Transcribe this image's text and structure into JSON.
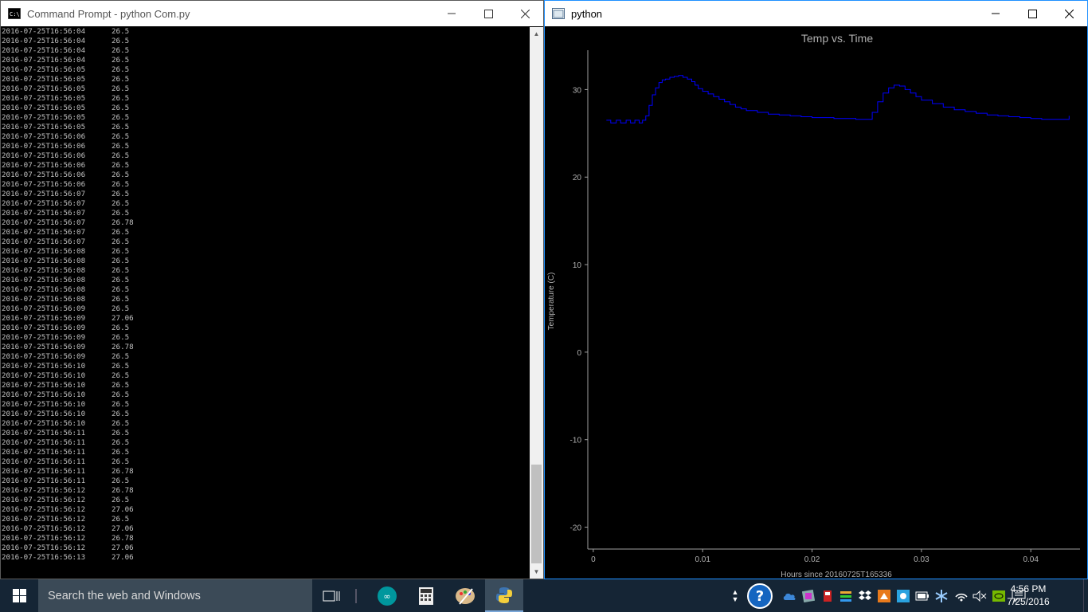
{
  "cmd_window": {
    "title": "Command Prompt - python  Com.py",
    "log": [
      {
        "ts": "2016-07-25T16:56:04",
        "val": "26.5"
      },
      {
        "ts": "2016-07-25T16:56:04",
        "val": "26.5"
      },
      {
        "ts": "2016-07-25T16:56:04",
        "val": "26.5"
      },
      {
        "ts": "2016-07-25T16:56:04",
        "val": "26.5"
      },
      {
        "ts": "2016-07-25T16:56:05",
        "val": "26.5"
      },
      {
        "ts": "2016-07-25T16:56:05",
        "val": "26.5"
      },
      {
        "ts": "2016-07-25T16:56:05",
        "val": "26.5"
      },
      {
        "ts": "2016-07-25T16:56:05",
        "val": "26.5"
      },
      {
        "ts": "2016-07-25T16:56:05",
        "val": "26.5"
      },
      {
        "ts": "2016-07-25T16:56:05",
        "val": "26.5"
      },
      {
        "ts": "2016-07-25T16:56:05",
        "val": "26.5"
      },
      {
        "ts": "2016-07-25T16:56:06",
        "val": "26.5"
      },
      {
        "ts": "2016-07-25T16:56:06",
        "val": "26.5"
      },
      {
        "ts": "2016-07-25T16:56:06",
        "val": "26.5"
      },
      {
        "ts": "2016-07-25T16:56:06",
        "val": "26.5"
      },
      {
        "ts": "2016-07-25T16:56:06",
        "val": "26.5"
      },
      {
        "ts": "2016-07-25T16:56:06",
        "val": "26.5"
      },
      {
        "ts": "2016-07-25T16:56:07",
        "val": "26.5"
      },
      {
        "ts": "2016-07-25T16:56:07",
        "val": "26.5"
      },
      {
        "ts": "2016-07-25T16:56:07",
        "val": "26.5"
      },
      {
        "ts": "2016-07-25T16:56:07",
        "val": "26.78"
      },
      {
        "ts": "2016-07-25T16:56:07",
        "val": "26.5"
      },
      {
        "ts": "2016-07-25T16:56:07",
        "val": "26.5"
      },
      {
        "ts": "2016-07-25T16:56:08",
        "val": "26.5"
      },
      {
        "ts": "2016-07-25T16:56:08",
        "val": "26.5"
      },
      {
        "ts": "2016-07-25T16:56:08",
        "val": "26.5"
      },
      {
        "ts": "2016-07-25T16:56:08",
        "val": "26.5"
      },
      {
        "ts": "2016-07-25T16:56:08",
        "val": "26.5"
      },
      {
        "ts": "2016-07-25T16:56:08",
        "val": "26.5"
      },
      {
        "ts": "2016-07-25T16:56:09",
        "val": "26.5"
      },
      {
        "ts": "2016-07-25T16:56:09",
        "val": "27.06"
      },
      {
        "ts": "2016-07-25T16:56:09",
        "val": "26.5"
      },
      {
        "ts": "2016-07-25T16:56:09",
        "val": "26.5"
      },
      {
        "ts": "2016-07-25T16:56:09",
        "val": "26.78"
      },
      {
        "ts": "2016-07-25T16:56:09",
        "val": "26.5"
      },
      {
        "ts": "2016-07-25T16:56:10",
        "val": "26.5"
      },
      {
        "ts": "2016-07-25T16:56:10",
        "val": "26.5"
      },
      {
        "ts": "2016-07-25T16:56:10",
        "val": "26.5"
      },
      {
        "ts": "2016-07-25T16:56:10",
        "val": "26.5"
      },
      {
        "ts": "2016-07-25T16:56:10",
        "val": "26.5"
      },
      {
        "ts": "2016-07-25T16:56:10",
        "val": "26.5"
      },
      {
        "ts": "2016-07-25T16:56:10",
        "val": "26.5"
      },
      {
        "ts": "2016-07-25T16:56:11",
        "val": "26.5"
      },
      {
        "ts": "2016-07-25T16:56:11",
        "val": "26.5"
      },
      {
        "ts": "2016-07-25T16:56:11",
        "val": "26.5"
      },
      {
        "ts": "2016-07-25T16:56:11",
        "val": "26.5"
      },
      {
        "ts": "2016-07-25T16:56:11",
        "val": "26.78"
      },
      {
        "ts": "2016-07-25T16:56:11",
        "val": "26.5"
      },
      {
        "ts": "2016-07-25T16:56:12",
        "val": "26.78"
      },
      {
        "ts": "2016-07-25T16:56:12",
        "val": "26.5"
      },
      {
        "ts": "2016-07-25T16:56:12",
        "val": "27.06"
      },
      {
        "ts": "2016-07-25T16:56:12",
        "val": "26.5"
      },
      {
        "ts": "2016-07-25T16:56:12",
        "val": "27.06"
      },
      {
        "ts": "2016-07-25T16:56:12",
        "val": "26.78"
      },
      {
        "ts": "2016-07-25T16:56:12",
        "val": "27.06"
      },
      {
        "ts": "2016-07-25T16:56:13",
        "val": "27.06"
      }
    ]
  },
  "plot_window": {
    "title": "python"
  },
  "chart_data": {
    "type": "line",
    "title": "Temp vs. Time",
    "xlabel": "Hours since 20160725T165336",
    "ylabel": "Temperature (C)",
    "xlim": [
      -0.0005,
      0.0445
    ],
    "ylim": [
      -22.5,
      34.5
    ],
    "x_ticks": [
      0,
      0.01,
      0.02,
      0.03,
      0.04
    ],
    "x_tick_labels": [
      "0",
      "0.01",
      "0.02",
      "0.03",
      "0.04"
    ],
    "y_ticks": [
      30,
      20,
      10,
      0,
      -10,
      -20
    ],
    "y_tick_labels": [
      "30",
      "20",
      "10",
      "0",
      "-10",
      "-20"
    ],
    "grid": false,
    "series": [
      {
        "color": "#0000ff",
        "x": [
          0.0012,
          0.0016,
          0.0021,
          0.0025,
          0.003,
          0.0034,
          0.0038,
          0.0042,
          0.0045,
          0.0048,
          0.0051,
          0.0054,
          0.0057,
          0.006,
          0.0063,
          0.0066,
          0.007,
          0.0074,
          0.0078,
          0.0082,
          0.0086,
          0.009,
          0.0093,
          0.0096,
          0.01,
          0.0105,
          0.011,
          0.0115,
          0.012,
          0.0125,
          0.013,
          0.0135,
          0.014,
          0.015,
          0.016,
          0.017,
          0.018,
          0.019,
          0.02,
          0.021,
          0.022,
          0.023,
          0.024,
          0.025,
          0.0255,
          0.026,
          0.0265,
          0.027,
          0.0275,
          0.028,
          0.0285,
          0.029,
          0.0295,
          0.03,
          0.031,
          0.032,
          0.033,
          0.034,
          0.035,
          0.036,
          0.037,
          0.038,
          0.039,
          0.04,
          0.041,
          0.042,
          0.043,
          0.0435
        ],
        "y": [
          26.5,
          26.2,
          26.5,
          26.2,
          26.5,
          26.2,
          26.5,
          26.2,
          26.5,
          27.0,
          28.2,
          29.4,
          30.2,
          30.8,
          31.1,
          31.2,
          31.4,
          31.5,
          31.6,
          31.4,
          31.2,
          30.9,
          30.5,
          30.1,
          29.8,
          29.5,
          29.2,
          28.9,
          28.6,
          28.3,
          28.0,
          27.8,
          27.6,
          27.4,
          27.2,
          27.1,
          27.0,
          26.9,
          26.8,
          26.8,
          26.7,
          26.7,
          26.6,
          26.6,
          27.4,
          28.6,
          29.6,
          30.2,
          30.5,
          30.4,
          30.0,
          29.6,
          29.2,
          28.8,
          28.4,
          28.0,
          27.7,
          27.5,
          27.3,
          27.1,
          27.0,
          26.9,
          26.8,
          26.7,
          26.6,
          26.6,
          26.6,
          27.0
        ]
      }
    ]
  },
  "taskbar": {
    "search_placeholder": "Search the web and Windows",
    "time": "4:56 PM",
    "date": "7/25/2016"
  },
  "colors": {
    "plot_line": "#0000ff",
    "axis": "#a0a0a0",
    "console_text": "#c0c0c0",
    "taskbar": "#152535",
    "active_border": "#1e90ff"
  }
}
